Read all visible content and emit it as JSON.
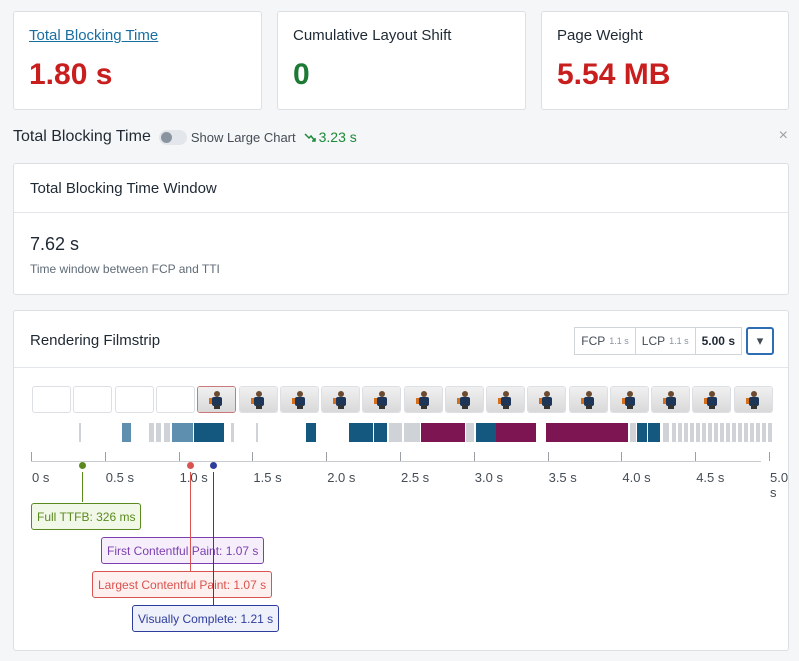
{
  "metrics": [
    {
      "title": "Total Blocking Time",
      "value": "1.80 s",
      "status": "red",
      "link": true
    },
    {
      "title": "Cumulative Layout Shift",
      "value": "0",
      "status": "green",
      "link": false
    },
    {
      "title": "Page Weight",
      "value": "5.54 MB",
      "status": "red",
      "link": false
    }
  ],
  "section": {
    "title": "Total Blocking Time",
    "toggle_label": "Show Large Chart",
    "trend_value": "3.23 s",
    "close_glyph": "×"
  },
  "tbt_window": {
    "title": "Total Blocking Time Window",
    "value": "7.62 s",
    "description": "Time window between FCP and TTI"
  },
  "filmstrip": {
    "title": "Rendering Filmstrip",
    "fcp_label": "FCP",
    "fcp_value": "1.1 s",
    "lcp_label": "LCP",
    "lcp_value": "1.1 s",
    "interval": "5.00 s",
    "dropdown_glyph": "▾",
    "axis_labels": [
      "0 s",
      "0.5 s",
      "1.0 s",
      "1.5 s",
      "2.0 s",
      "2.5 s",
      "3.0 s",
      "3.5 s",
      "4.0 s",
      "4.5 s",
      "5.0 s"
    ],
    "frames_blank": 4,
    "frames_with_content": 14,
    "markers": [
      {
        "label": "Full TTFB: 326 ms",
        "color": "#5a8a1e",
        "bg": "#f2f8e8"
      },
      {
        "label": "First Contentful Paint: 1.07 s",
        "color": "#7b3fb0",
        "bg": "#f6effb"
      },
      {
        "label": "Largest Contentful Paint: 1.07 s",
        "color": "#d9534f",
        "bg": "#fdf0ef"
      },
      {
        "label": "Visually Complete: 1.21 s",
        "color": "#2e3d9b",
        "bg": "#eef0fa"
      }
    ]
  },
  "colors": {
    "blue": "#14577f",
    "lightblue": "#5e8fae",
    "maroon": "#7c1551",
    "grey": "#cfd2d6"
  }
}
